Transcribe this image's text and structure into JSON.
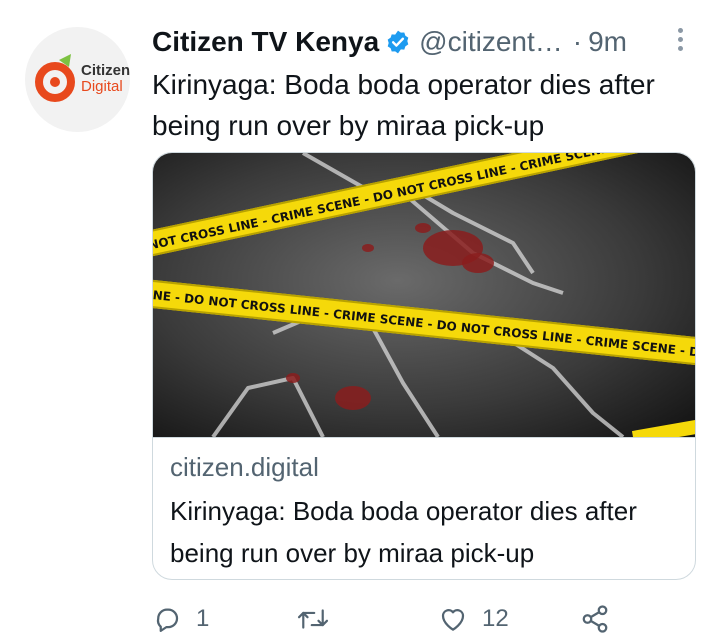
{
  "author": {
    "avatar_logo_line1": "Citizen",
    "avatar_logo_line2": "Digital",
    "name": "Citizen TV Kenya",
    "handle": "@citizent…",
    "separator": "·",
    "time": "9m"
  },
  "tweet": {
    "text": "Kirinyaga: Boda boda operator dies after being run over by miraa pick-up"
  },
  "card": {
    "image_tape_text_1": "NOT CROSS LINE - CRIME SCENE - DO NOT CROSS LINE - CRIME SCENE",
    "image_tape_text_2": "NE - DO NOT CROSS LINE - CRIME SCENE - DO NOT CROSS LINE - CRIME SCENE - D",
    "domain": "citizen.digital",
    "title": "Kirinyaga: Boda boda operator dies after being run over by miraa pick-up"
  },
  "actions": {
    "reply_count": "1",
    "retweet_count": "",
    "like_count": "12"
  },
  "colors": {
    "verified_blue": "#1d9bf0",
    "muted_text": "#536471",
    "logo_orange": "#e8491d",
    "logo_green": "#7dc242",
    "tape_yellow": "#f5d90a"
  }
}
